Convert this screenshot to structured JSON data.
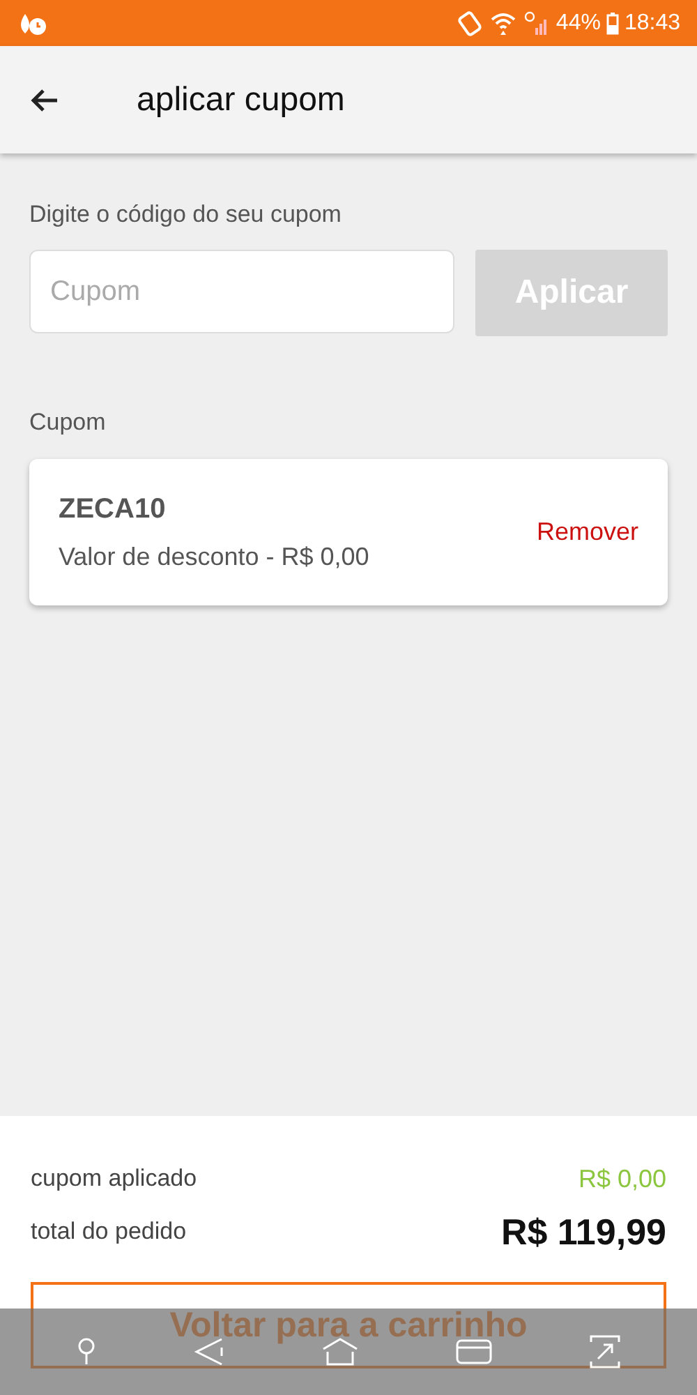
{
  "status_bar": {
    "battery": "44%",
    "time": "18:43"
  },
  "header": {
    "title": "aplicar cupom"
  },
  "coupon_form": {
    "label": "Digite o código do seu cupom",
    "placeholder": "Cupom",
    "button": "Aplicar",
    "button_disabled": true
  },
  "applied": {
    "heading": "Cupom",
    "code": "ZECA10",
    "description": "Valor de desconto - R$ 0,00",
    "remove": "Remover"
  },
  "summary": {
    "rows": [
      {
        "label": "cupom aplicado",
        "value": "R$ 0,00",
        "kind": "discount"
      },
      {
        "label": "total do pedido",
        "value": "R$ 119,99",
        "kind": "total"
      }
    ],
    "button": "Voltar para a carrinho"
  }
}
